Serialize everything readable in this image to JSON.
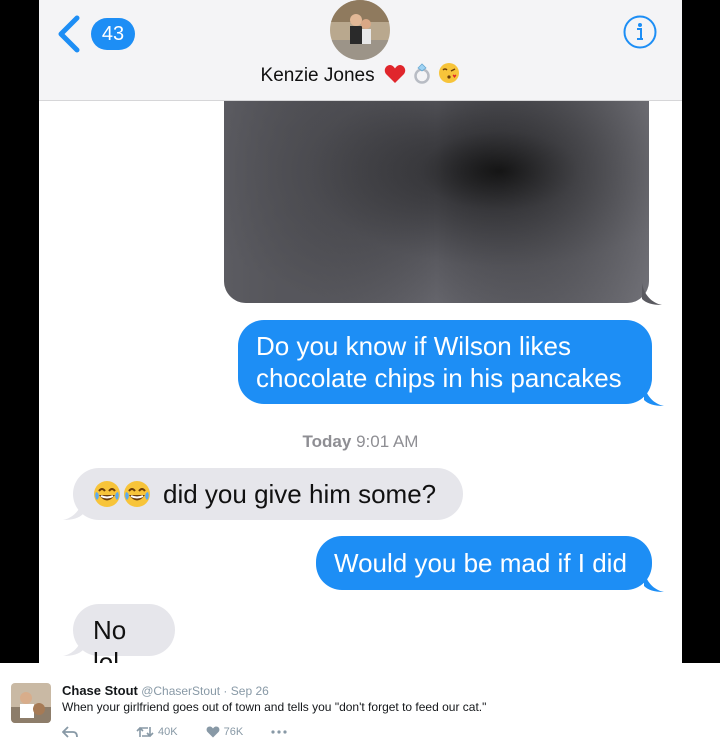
{
  "header": {
    "back_count": "43",
    "contact_name": "Kenzie Jones",
    "name_emoji_icons": [
      "red-heart-icon",
      "ring-icon",
      "kissing-face-icon"
    ]
  },
  "messages": [
    {
      "type": "image",
      "direction": "incoming",
      "icon": "blurred-photo-icon"
    },
    {
      "type": "text",
      "direction": "outgoing",
      "text": "Do you know if Wilson likes chocolate chips in his pancakes"
    },
    {
      "type": "timestamp",
      "day": "Today",
      "time": "9:01 AM"
    },
    {
      "type": "text",
      "direction": "incoming",
      "emoji": [
        "joy-icon",
        "joy-icon"
      ],
      "text": "did you give him some?"
    },
    {
      "type": "text",
      "direction": "outgoing",
      "text": "Would you be mad if I did"
    },
    {
      "type": "text",
      "direction": "incoming",
      "text": "No lol"
    }
  ],
  "tweet": {
    "name": "Chase Stout",
    "handle": "@ChaserStout",
    "date": "Sep 26",
    "text": "When your girlfriend goes out of town and tells you \"don't forget to feed our cat.\"",
    "retweets": "40K",
    "likes": "76K"
  },
  "colors": {
    "ios_blue": "#1d8ef5",
    "incoming_bubble": "#e6e6eb",
    "header_bg": "#f4f4f6"
  }
}
